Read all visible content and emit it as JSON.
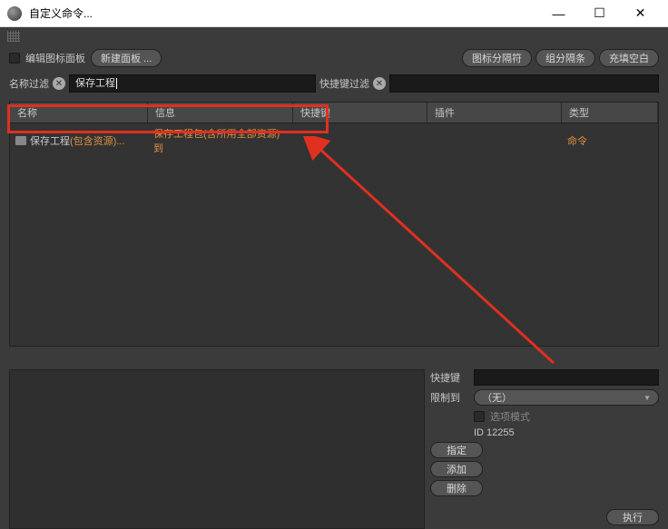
{
  "titlebar": {
    "title": "自定义命令..."
  },
  "toolbar": {
    "edit_panel_label": "编辑图标面板",
    "new_panel_label": "新建面板 ...",
    "icon_separator": "图标分隔符",
    "group_separator": "组分隔条",
    "fill_space": "充填空白"
  },
  "filters": {
    "name_label": "名称过滤",
    "name_value": "保存工程",
    "key_label": "快捷键过滤"
  },
  "table": {
    "headers": {
      "name": "名称",
      "info": "信息",
      "key": "快捷键",
      "plugin": "插件",
      "type": "类型"
    },
    "rows": [
      {
        "name_prefix": "保存工程",
        "name_suffix": "(包含资源)...",
        "info": "保存工程包(含所用全部资源)到",
        "key": "",
        "plugin": "",
        "type": "命令"
      }
    ]
  },
  "detail": {
    "shortcut_label": "快捷键",
    "restrict_label": "限制到",
    "restrict_value": "（无）",
    "option_mode_label": "选项模式",
    "id_label": "ID 12255",
    "assign_btn": "指定",
    "add_btn": "添加",
    "delete_btn": "删除",
    "execute_btn": "执行"
  }
}
